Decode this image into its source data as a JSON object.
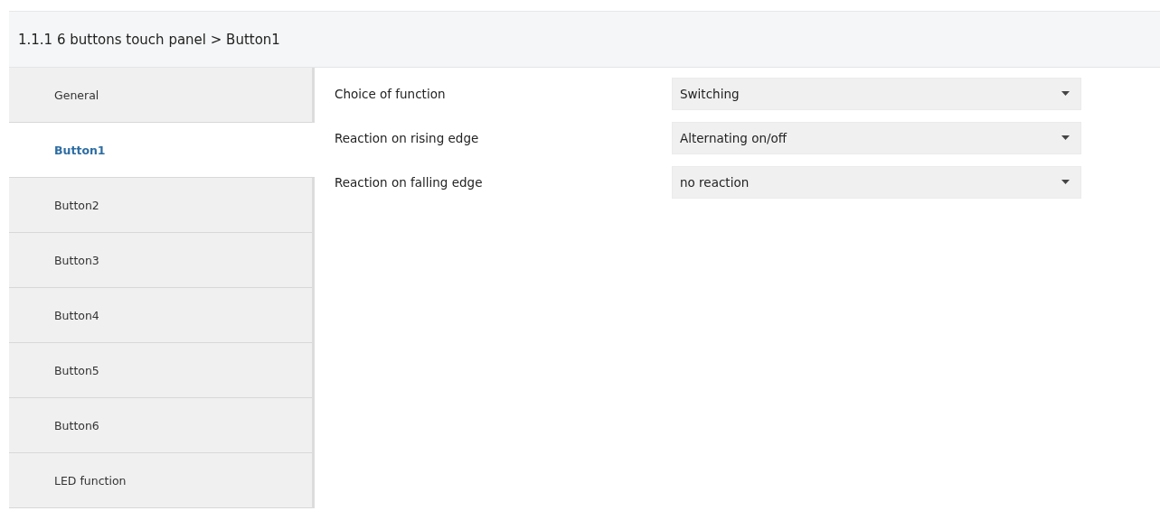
{
  "header": {
    "title": "1.1.1 6 buttons touch panel > Button1"
  },
  "sidebar": {
    "items": [
      {
        "label": "General",
        "selected": false
      },
      {
        "label": "Button1",
        "selected": true
      },
      {
        "label": "Button2",
        "selected": false
      },
      {
        "label": "Button3",
        "selected": false
      },
      {
        "label": "Button4",
        "selected": false
      },
      {
        "label": "Button5",
        "selected": false
      },
      {
        "label": "Button6",
        "selected": false
      },
      {
        "label": "LED function",
        "selected": false
      }
    ]
  },
  "parameters": [
    {
      "label": "Choice of function",
      "value": "Switching"
    },
    {
      "label": "Reaction on rising edge",
      "value": "Alternating on/off"
    },
    {
      "label": "Reaction on falling edge",
      "value": "no reaction"
    }
  ]
}
